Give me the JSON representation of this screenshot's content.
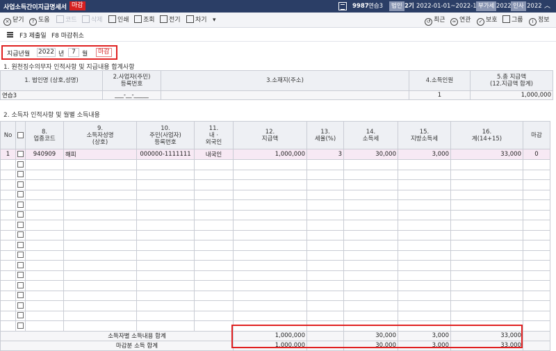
{
  "titlebar": {
    "title": "사업소득간이지급명세서",
    "status_badge": "마감",
    "company_code": "9987",
    "company_name": "연습3",
    "corp_label": "법인",
    "term": "2기",
    "period": "2022-01-01~2022-12-31",
    "vat_label": "부가세",
    "vat_year": "2022",
    "hr_label": "인사",
    "hr_year": "2022"
  },
  "toolbar": {
    "close": "닫기",
    "help": "도움",
    "code": "코드",
    "delete": "삭제",
    "print": "인쇄",
    "query": "조회",
    "send": "전기",
    "more": "차기",
    "recent": "최근",
    "link": "연관",
    "protect": "보호",
    "group": "그룹",
    "info": "정보"
  },
  "subbar": {
    "f3": "F3 제출일",
    "f8": "F8 마감취소"
  },
  "period_filter": {
    "label": "지급년월",
    "year": "2022",
    "year_unit": "년",
    "month": "7",
    "month_unit": "월",
    "closed_badge": "마감"
  },
  "section1": {
    "title": "1. 원천징수의무자 인적사항 및 지급내용 합계사항",
    "headers": [
      "1. 법인명 (상호,성명)",
      "2.사업자(주민)\n등록번호",
      "3.소재지(주소)",
      "4.소득인원",
      "5.총 지급액\n(12.지급액 합계)"
    ],
    "row": {
      "name": "연습3",
      "reg_no": "___-__-_____",
      "address": "",
      "count": "1",
      "total": "1,000,000"
    }
  },
  "section2": {
    "title": "2. 소득자 인적사항 및 월별 소득내용",
    "headers": {
      "no": "No",
      "code": "8.\n업종코드",
      "name": "9.\n소득자성명\n(상호)",
      "reg": "10.\n주민(사업자)\n등록번호",
      "nat": "11.\n내 ·\n외국인",
      "pay": "12.\n지급액",
      "rate": "13.\n세율(%)",
      "tax": "14.\n소득세",
      "local": "15.\n지방소득세",
      "sum": "16.\n계(14+15)",
      "closed": "마감"
    },
    "rows": [
      {
        "no": "1",
        "code": "940909",
        "name": "해피",
        "reg": "000000-1111111",
        "nat": "내국인",
        "pay": "1,000,000",
        "rate": "3",
        "tax": "30,000",
        "local": "3,000",
        "sum": "33,000",
        "closed": "0"
      }
    ],
    "empty_rows": 17,
    "totals": [
      {
        "label": "소득자별 소득내용 합계",
        "pay": "1,000,000",
        "tax": "30,000",
        "local": "3,000",
        "sum": "33,000"
      },
      {
        "label": "마감분 소득 합계",
        "pay": "1,000,000",
        "tax": "30,000",
        "local": "3,000",
        "sum": "33,000"
      }
    ]
  }
}
